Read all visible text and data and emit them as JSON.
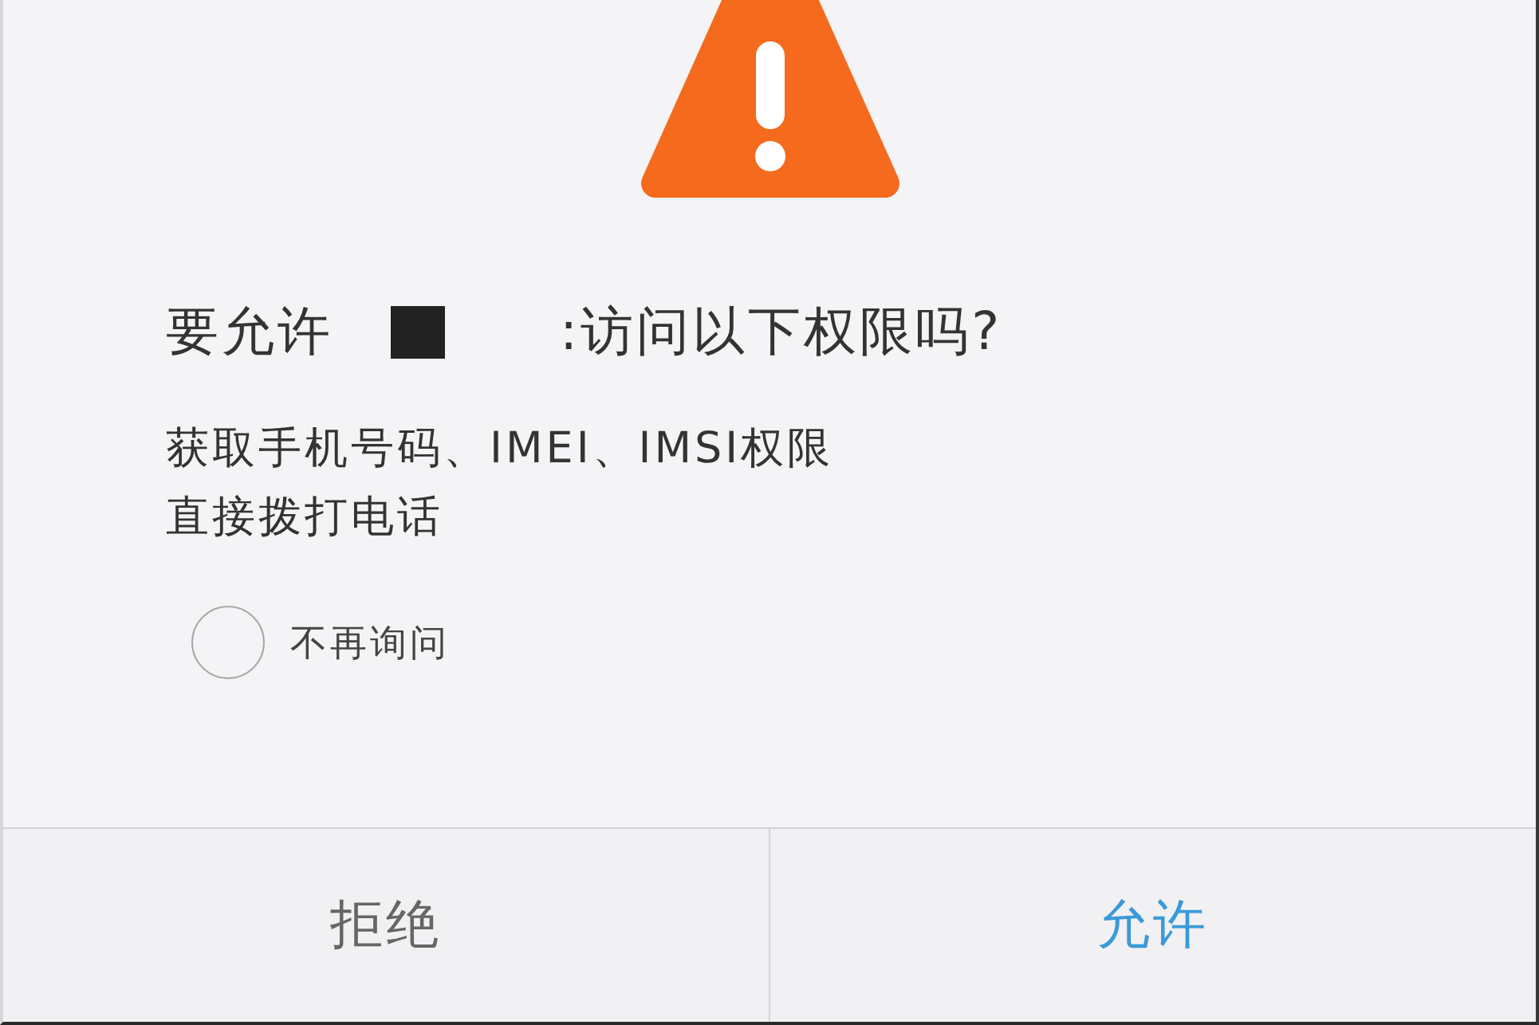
{
  "dialog": {
    "title": {
      "before": "要允许",
      "after": ":访问以下权限吗?"
    },
    "permissions": [
      "获取手机号码、IMEI、IMSI权限",
      "直接拨打电话"
    ],
    "dont_ask_again": {
      "label": "不再询问",
      "checked": false
    },
    "buttons": [
      {
        "label": "拒绝",
        "kind": "secondary"
      },
      {
        "label": "允许",
        "kind": "primary"
      }
    ]
  }
}
